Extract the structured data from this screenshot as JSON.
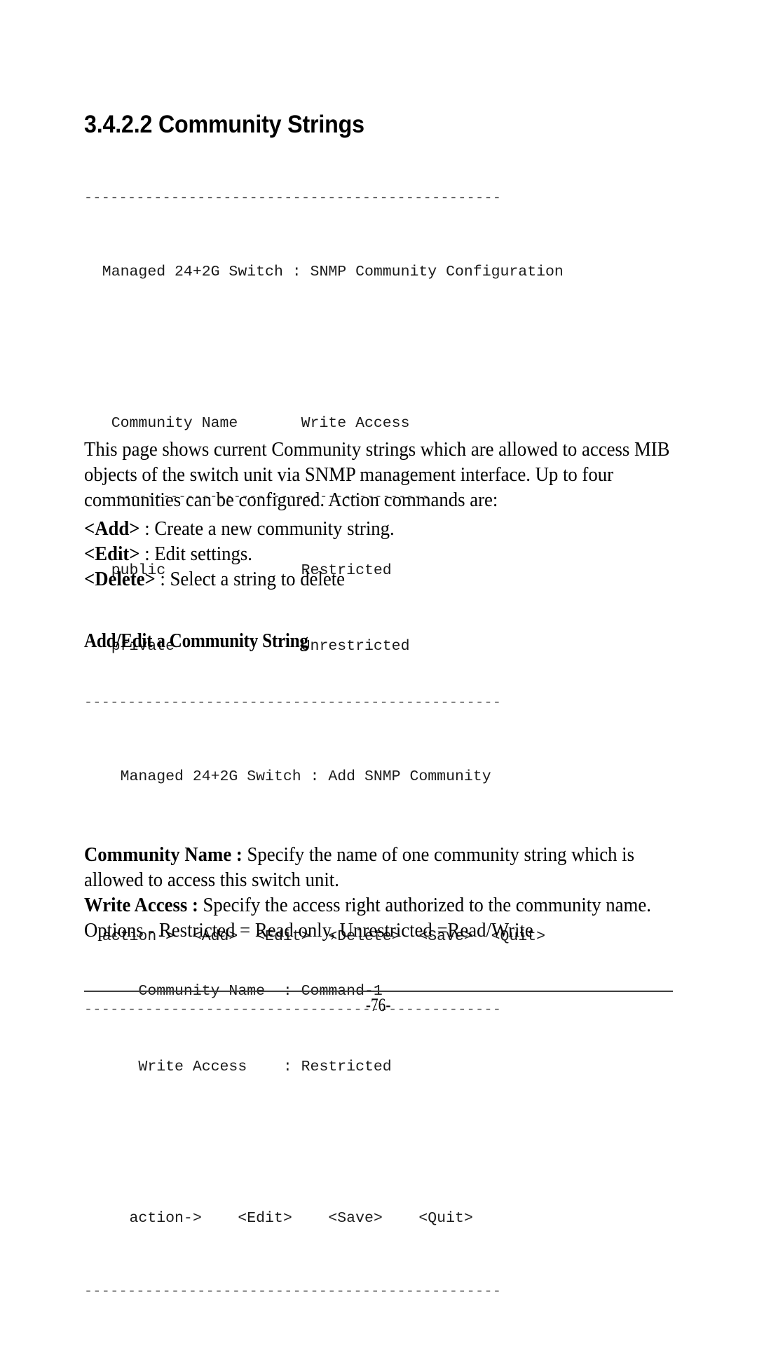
{
  "heading": {
    "number": "3.4.2.2",
    "title": "Community Strings",
    "full": "3.4.2.2 Community Strings"
  },
  "console_1": {
    "top_rule": "------------------------------------------------",
    "title": "  Managed 24+2G Switch : SNMP Community Configuration",
    "column_header": "   Community Name       Write Access",
    "inner_rule": "----------------------------------------",
    "rows": [
      "   public               Restricted",
      "   private              Unrestricted"
    ],
    "action_line": "  action->  <Add>  <Edit>  <Delete>  <Save>  <Quit>",
    "bottom_rule": "------------------------------------------------",
    "columns": [
      "Community Name",
      "Write Access"
    ],
    "data": [
      {
        "community_name": "public",
        "write_access": "Restricted"
      },
      {
        "community_name": "private",
        "write_access": "Unrestricted"
      }
    ],
    "actions": [
      "<Add>",
      "<Edit>",
      "<Delete>",
      "<Save>",
      "<Quit>"
    ],
    "action_prompt": "action->"
  },
  "intro_paragraph": "This page shows current Community strings which are allowed to access MIB objects of the switch unit via SNMP management interface. Up to four communities can be configured. Action commands are:",
  "action_commands": [
    {
      "term": "<Add>",
      "separator": " : ",
      "description": "Create a new community string."
    },
    {
      "term": "<Edit>",
      "separator": " : ",
      "description": "Edit settings."
    },
    {
      "term": "<Delete>",
      "separator": " : ",
      "description": "Select a string to delete"
    }
  ],
  "sub_heading": "Add/Edit a Community String",
  "console_2": {
    "top_rule": "------------------------------------------------",
    "title": "    Managed 24+2G Switch : Add SNMP Community",
    "fields": [
      "      Community Name  : Command-1",
      "      Write Access    : Restricted"
    ],
    "action_line": "     action->    <Edit>    <Save>    <Quit>",
    "bottom_rule": "------------------------------------------------",
    "field_data": [
      {
        "label": "Community Name",
        "value": "Command-1"
      },
      {
        "label": "Write Access",
        "value": "Restricted"
      }
    ],
    "actions": [
      "<Edit>",
      "<Save>",
      "<Quit>"
    ],
    "action_prompt": "action->"
  },
  "field_descriptions": [
    {
      "term": "Community Name :",
      "description": " Specify the name of one community string which is allowed to access this switch unit."
    },
    {
      "term": "Write Access :",
      "description": " Specify the access right authorized to the community name."
    }
  ],
  "options_line": "Options - Restricted = Read only, Unrestricted =Read/Write",
  "footer": {
    "page_number": "-76-"
  }
}
